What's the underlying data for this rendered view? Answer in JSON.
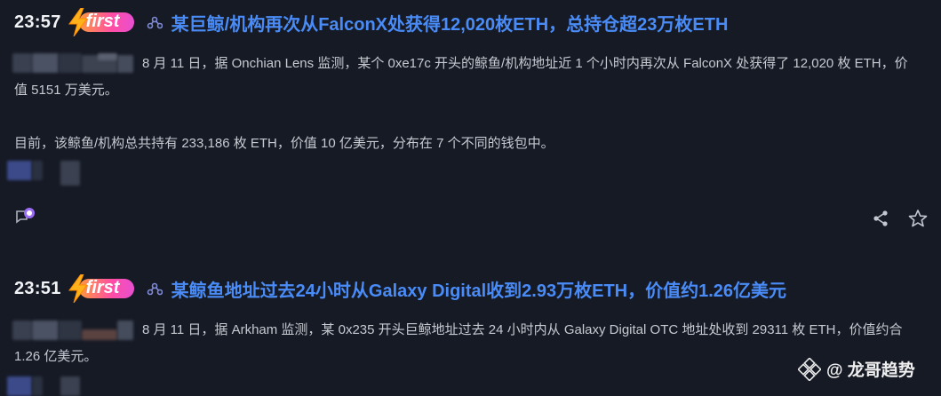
{
  "items": [
    {
      "time": "23:57",
      "badge": "first",
      "title": "某巨鲸/机构再次从FalconX处获得12,020枚ETH，总持仓超23万枚ETH",
      "paragraph1": "8 月 11 日，据 Onchian Lens 监测，某个 0xe17c 开头的鲸鱼/机构地址近 1 个小时内再次从 FalconX 处获得了 12,020 枚 ETH，价值 5151 万美元。",
      "paragraph2": "目前，该鲸鱼/机构总共持有 233,186 枚 ETH，价值 10 亿美元，分布在 7 个不同的钱包中。"
    },
    {
      "time": "23:51",
      "badge": "first",
      "title": "某鲸鱼地址过去24小时从Galaxy Digital收到2.93万枚ETH，价值约1.26亿美元",
      "paragraph1": "8 月 11 日，据 Arkham 监测，某 0x235 开头巨鲸地址过去 24 小时内从 Galaxy Digital OTC 地址处收到 29311 枚 ETH，价值约合 1.26 亿美元。"
    }
  ],
  "watermark": {
    "text": "@ 龙哥趋势"
  },
  "colors": {
    "background": "#161a25",
    "title": "#4a8cf7",
    "badge_start": "#ff9a3c",
    "badge_end": "#e84fd0"
  },
  "icons": {
    "comment": "comment-icon",
    "share": "share-icon",
    "star": "star-icon",
    "link": "link-icon",
    "bolt": "bolt-icon"
  }
}
